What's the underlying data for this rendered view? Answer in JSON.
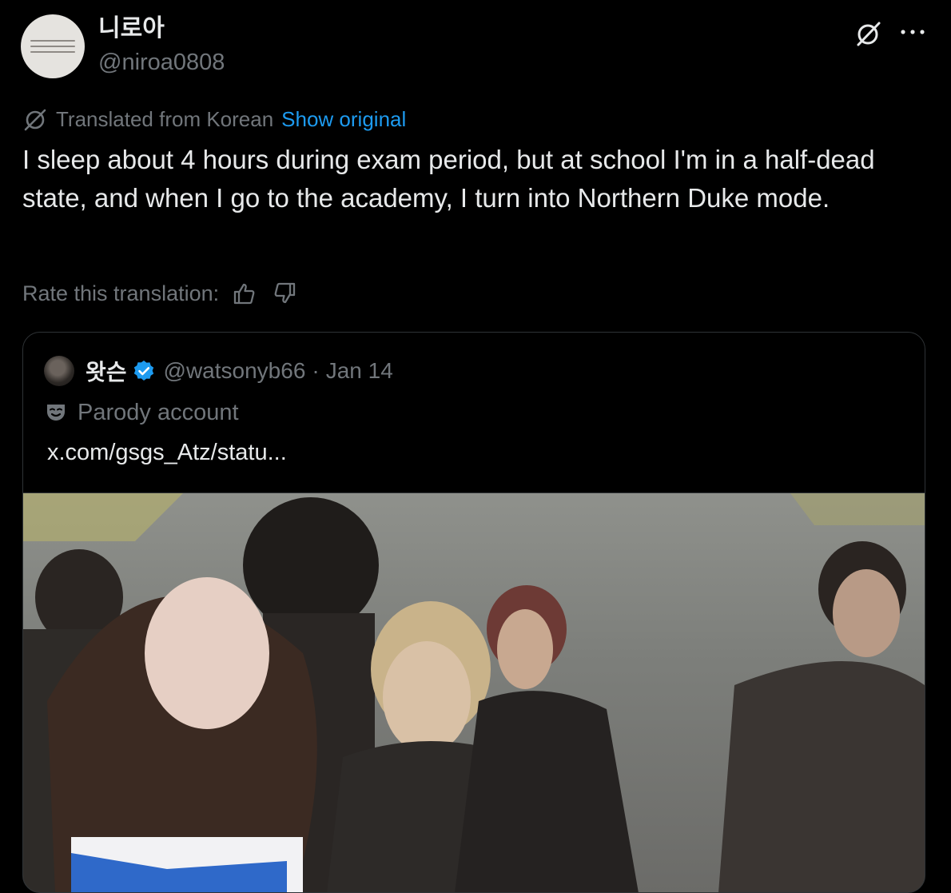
{
  "post": {
    "author": {
      "display_name": "니로아",
      "handle": "@niroa0808"
    },
    "translation": {
      "label": "Translated from Korean",
      "show_original": "Show original"
    },
    "text": "I sleep about 4 hours during exam period, but at school I'm in a half-dead state, and when I go to the academy, I turn into Northern Duke mode.",
    "rate_label": "Rate this translation:"
  },
  "quote": {
    "author": {
      "display_name": "왓슨",
      "handle": "@watsonyb66",
      "separator": "·",
      "date": "Jan 14"
    },
    "parody_label": "Parody account",
    "link_text": "x.com/gsgs_Atz/statu..."
  },
  "colors": {
    "background": "#000000",
    "text": "#e7e9ea",
    "muted": "#71767b",
    "link": "#1d9bf0",
    "border": "#2f3336"
  },
  "icons": {
    "grok": "grok-icon",
    "more": "more-icon",
    "translate": "translate-icon",
    "thumbs_up": "thumbs-up-icon",
    "thumbs_down": "thumbs-down-icon",
    "verified": "verified-badge-icon",
    "parody": "parody-mask-icon"
  }
}
